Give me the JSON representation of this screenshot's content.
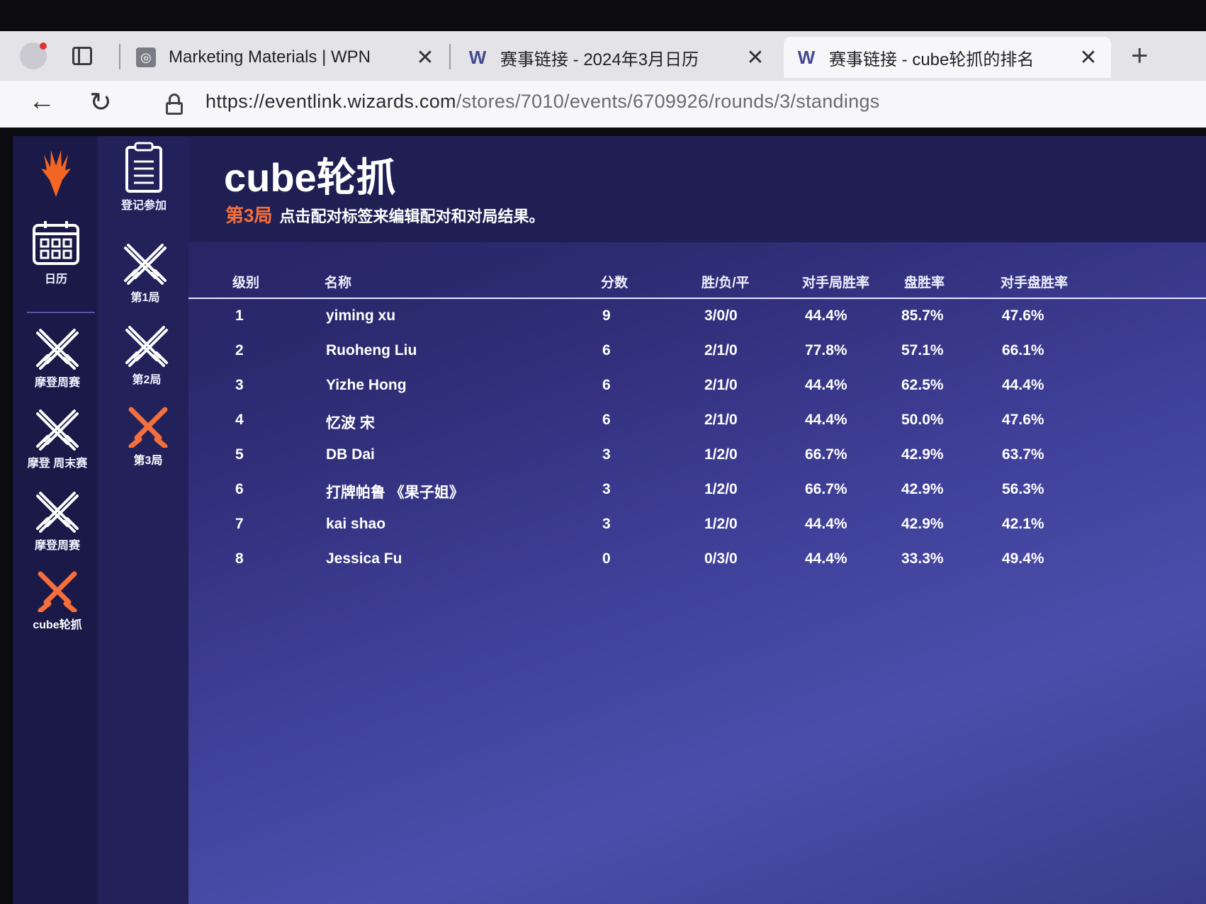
{
  "browser": {
    "tabs": [
      {
        "title": "Marketing Materials | WPN",
        "favicon": "wpn-favicon",
        "active": false
      },
      {
        "title": "赛事链接 - 2024年3月日历",
        "favicon": "W",
        "active": false
      },
      {
        "title": "赛事链接 - cube轮抓的排名",
        "favicon": "W",
        "active": true
      }
    ],
    "url_host": "https://eventlink.wizards.com",
    "url_path": "/stores/7010/events/6709926/rounds/3/standings",
    "newtab": "+",
    "close": "✕"
  },
  "sidebar": {
    "items": [
      {
        "label": "日历",
        "icon": "calendar-icon"
      },
      {
        "label": "摩登周赛",
        "icon": "crossed-swords-icon"
      },
      {
        "label": "摩登 周末赛",
        "icon": "crossed-swords-icon"
      },
      {
        "label": "摩登周赛",
        "icon": "crossed-swords-icon"
      },
      {
        "label": "cube轮抓",
        "icon": "crossed-swords-icon",
        "active": true
      }
    ]
  },
  "subnav": {
    "items": [
      {
        "label": "登记参加",
        "icon": "clipboard-icon"
      },
      {
        "label": "第1局",
        "icon": "crossed-swords-icon"
      },
      {
        "label": "第2局",
        "icon": "crossed-swords-icon"
      },
      {
        "label": "第3局",
        "icon": "crossed-swords-icon",
        "active": true
      }
    ]
  },
  "header": {
    "title": "cube轮抓",
    "round": "第3局",
    "instruction": "点击配对标签来编辑配对和对局结果。"
  },
  "standings": {
    "columns": [
      "级别",
      "名称",
      "分数",
      "胜/负/平",
      "对手局胜率",
      "盘胜率",
      "对手盘胜率"
    ],
    "rows": [
      [
        "1",
        "yiming xu",
        "9",
        "3/0/0",
        "44.4%",
        "85.7%",
        "47.6%"
      ],
      [
        "2",
        "Ruoheng Liu",
        "6",
        "2/1/0",
        "77.8%",
        "57.1%",
        "66.1%"
      ],
      [
        "3",
        "Yizhe Hong",
        "6",
        "2/1/0",
        "44.4%",
        "62.5%",
        "44.4%"
      ],
      [
        "4",
        "忆波 宋",
        "6",
        "2/1/0",
        "44.4%",
        "50.0%",
        "47.6%"
      ],
      [
        "5",
        "DB Dai",
        "3",
        "1/2/0",
        "66.7%",
        "42.9%",
        "63.7%"
      ],
      [
        "6",
        "打牌帕鲁 《果子姐》",
        "3",
        "1/2/0",
        "66.7%",
        "42.9%",
        "56.3%"
      ],
      [
        "7",
        "kai shao",
        "3",
        "1/2/0",
        "44.4%",
        "42.9%",
        "42.1%"
      ],
      [
        "8",
        "Jessica Fu",
        "0",
        "0/3/0",
        "44.4%",
        "33.3%",
        "49.4%"
      ]
    ]
  },
  "colors": {
    "accent": "#f46f3b",
    "rail": "#1a1947",
    "header": "#201f54"
  }
}
